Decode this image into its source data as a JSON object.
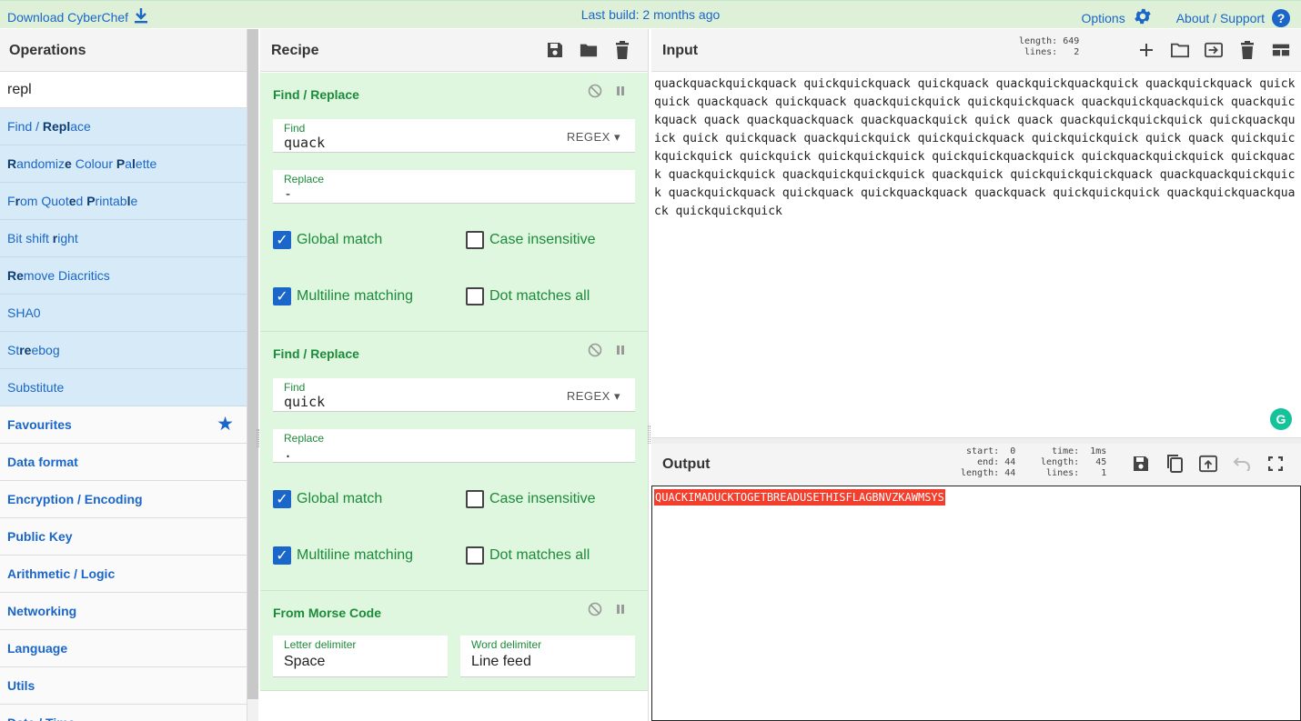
{
  "banner": {
    "download_label": "Download CyberChef",
    "last_build": "Last build: 2 months ago",
    "options_label": "Options",
    "about_label": "About / Support"
  },
  "operations": {
    "title": "Operations",
    "search_value": "repl",
    "results": [
      {
        "html": "Find / <b>Repl</b>ace"
      },
      {
        "html": "<b>R</b>andomiz<b>e</b> Colour <b>P</b>a<b>l</b>ette"
      },
      {
        "html": "F<b>r</b>om Quot<b>e</b>d <b>P</b>rintab<b>l</b>e"
      },
      {
        "html": "Bit shift <b>r</b>ight"
      },
      {
        "html": "<b>Re</b>move Diacritics"
      },
      {
        "html": "SHA0"
      },
      {
        "html": "St<b>re</b>ebog"
      },
      {
        "html": "Substitute"
      }
    ],
    "categories": [
      "Favourites",
      "Data format",
      "Encryption / Encoding",
      "Public Key",
      "Arithmetic / Logic",
      "Networking",
      "Language",
      "Utils",
      "Date / Time"
    ]
  },
  "recipe": {
    "title": "Recipe",
    "steps": [
      {
        "name": "Find / Replace",
        "find_label": "Find",
        "find": "quack",
        "mode": "REGEX",
        "replace_label": "Replace",
        "replace": "-",
        "global": "Global match",
        "case": "Case insensitive",
        "multiline": "Multiline matching",
        "dotall": "Dot matches all"
      },
      {
        "name": "Find / Replace",
        "find_label": "Find",
        "find": "quick",
        "mode": "REGEX",
        "replace_label": "Replace",
        "replace": ".",
        "global": "Global match",
        "case": "Case insensitive",
        "multiline": "Multiline matching",
        "dotall": "Dot matches all"
      },
      {
        "name": "From Morse Code",
        "letter_label": "Letter delimiter",
        "letter": "Space",
        "word_label": "Word delimiter",
        "word": "Line feed"
      }
    ]
  },
  "input": {
    "title": "Input",
    "length_label": "length:",
    "length": "649",
    "lines_label": "lines:",
    "lines": "2",
    "text": "quackquackquickquack quickquickquack quickquack quackquickquackquick quackquickquack quickquick quackquack quickquack quackquickquick quickquickquack quackquickquackquick quackquickquack quack quackquackquack quackquackquick quick quack quackquickquickquick quickquackquick quick quickquack quackquickquick quickquickquack quickquickquick quick quack quickquickquickquick quickquick quickquickquick quickquickquackquick quickquackquickquick quickquack quackquickquick quackquickquickquick quackquick quickquickquickquack quackquackquickquick quackquickquack quickquack quickquackquack quackquack quickquickquick quackquickquackquack quickquickquick"
  },
  "output": {
    "title": "Output",
    "start_label": "start:",
    "start": "0",
    "end_label": "end:",
    "end": "44",
    "olength_label": "length:",
    "olength": "44",
    "time_label": "time:",
    "time": "1ms",
    "length_label": "length:",
    "length": "45",
    "lines_label": "lines:",
    "lines": "1",
    "text": "QUACKIMADUCKTOGETBREADUSETHISFLAGBNVZKAWMSYS"
  }
}
